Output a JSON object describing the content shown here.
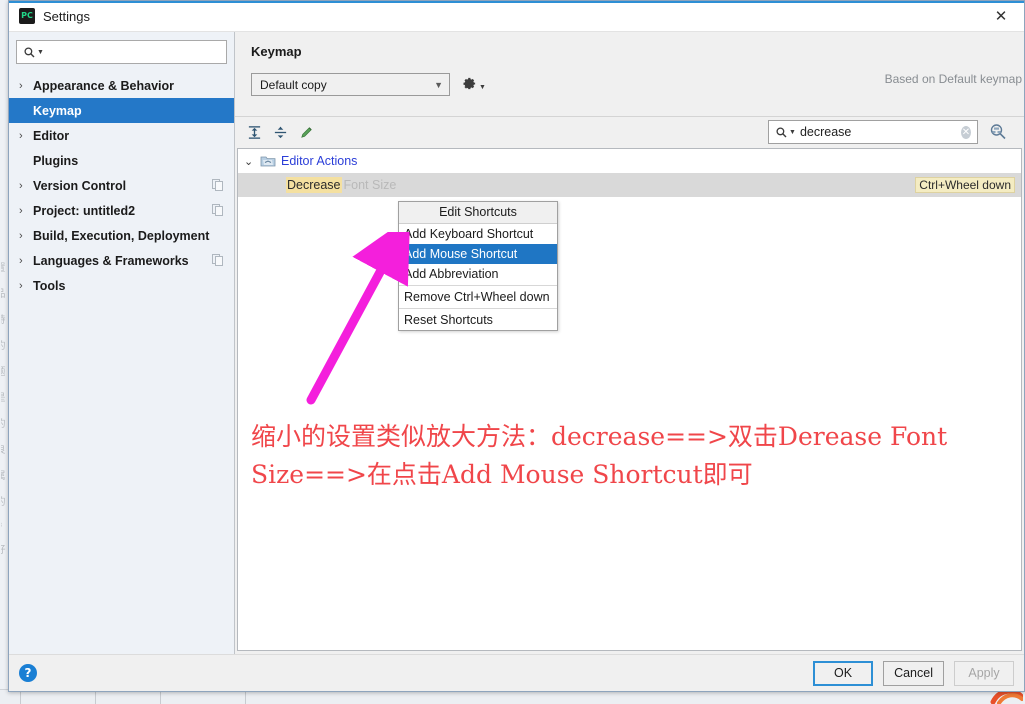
{
  "window": {
    "title": "Settings",
    "app_icon": "pycharm-icon",
    "close_label": "✕"
  },
  "sidebar": {
    "search": {
      "value": "",
      "placeholder": ""
    },
    "items": [
      {
        "label": "Appearance & Behavior",
        "expandable": true,
        "selected": false,
        "has_copy": false
      },
      {
        "label": "Keymap",
        "expandable": false,
        "selected": true,
        "has_copy": false
      },
      {
        "label": "Editor",
        "expandable": true,
        "selected": false,
        "has_copy": false
      },
      {
        "label": "Plugins",
        "expandable": false,
        "selected": false,
        "has_copy": false
      },
      {
        "label": "Version Control",
        "expandable": true,
        "selected": false,
        "has_copy": true
      },
      {
        "label": "Project: untitled2",
        "expandable": true,
        "selected": false,
        "has_copy": true
      },
      {
        "label": "Build, Execution, Deployment",
        "expandable": true,
        "selected": false,
        "has_copy": false
      },
      {
        "label": "Languages & Frameworks",
        "expandable": true,
        "selected": false,
        "has_copy": true
      },
      {
        "label": "Tools",
        "expandable": true,
        "selected": false,
        "has_copy": false
      }
    ]
  },
  "content": {
    "pane_title": "Keymap",
    "keymap_select": {
      "value": "Default copy"
    },
    "gear_label": "gear-icon",
    "based_on": "Based on Default keymap",
    "toolbar_icons": [
      "expand-all-icon",
      "collapse-all-icon",
      "edit-pencil-icon"
    ],
    "filter_search": {
      "value": "decrease",
      "placeholder": ""
    },
    "filter_icon": "filter-shortcut-icon",
    "tree": {
      "group": {
        "label": "Editor Actions",
        "expanded": true,
        "icon": "folder-actions-icon"
      },
      "rows": [
        {
          "match_text": "Decrease",
          "rest_text": "Font Size",
          "shortcut": "Ctrl+Wheel down"
        }
      ]
    }
  },
  "context_menu": {
    "header": "Edit Shortcuts",
    "items": [
      {
        "label": "Add Keyboard Shortcut",
        "highlighted": false,
        "separator_after": false
      },
      {
        "label": "Add Mouse Shortcut",
        "highlighted": true,
        "separator_after": false
      },
      {
        "label": "Add Abbreviation",
        "highlighted": false,
        "separator_after": true
      },
      {
        "label": "Remove Ctrl+Wheel down",
        "highlighted": false,
        "separator_after": true
      },
      {
        "label": "Reset Shortcuts",
        "highlighted": false,
        "separator_after": false
      }
    ]
  },
  "annotation": {
    "arrow_color": "#f41fdc",
    "text_color": "#f0464a",
    "line1": "缩小的设置类似放大方法：decrease==>双击Derease Font",
    "line2": "Size==>在点击Add Mouse Shortcut即可"
  },
  "footer": {
    "help_label": "?",
    "ok_label": "OK",
    "cancel_label": "Cancel",
    "apply_label": "Apply"
  },
  "colors": {
    "selection_blue": "#2478c8",
    "menu_highlight": "#1f76c4",
    "link_blue": "#2b3ed8",
    "match_yellow": "#f4e0a0",
    "annotation_magenta": "#f41fdc",
    "annotation_red": "#f0464a",
    "accent_title": "#2d8fd5"
  }
}
